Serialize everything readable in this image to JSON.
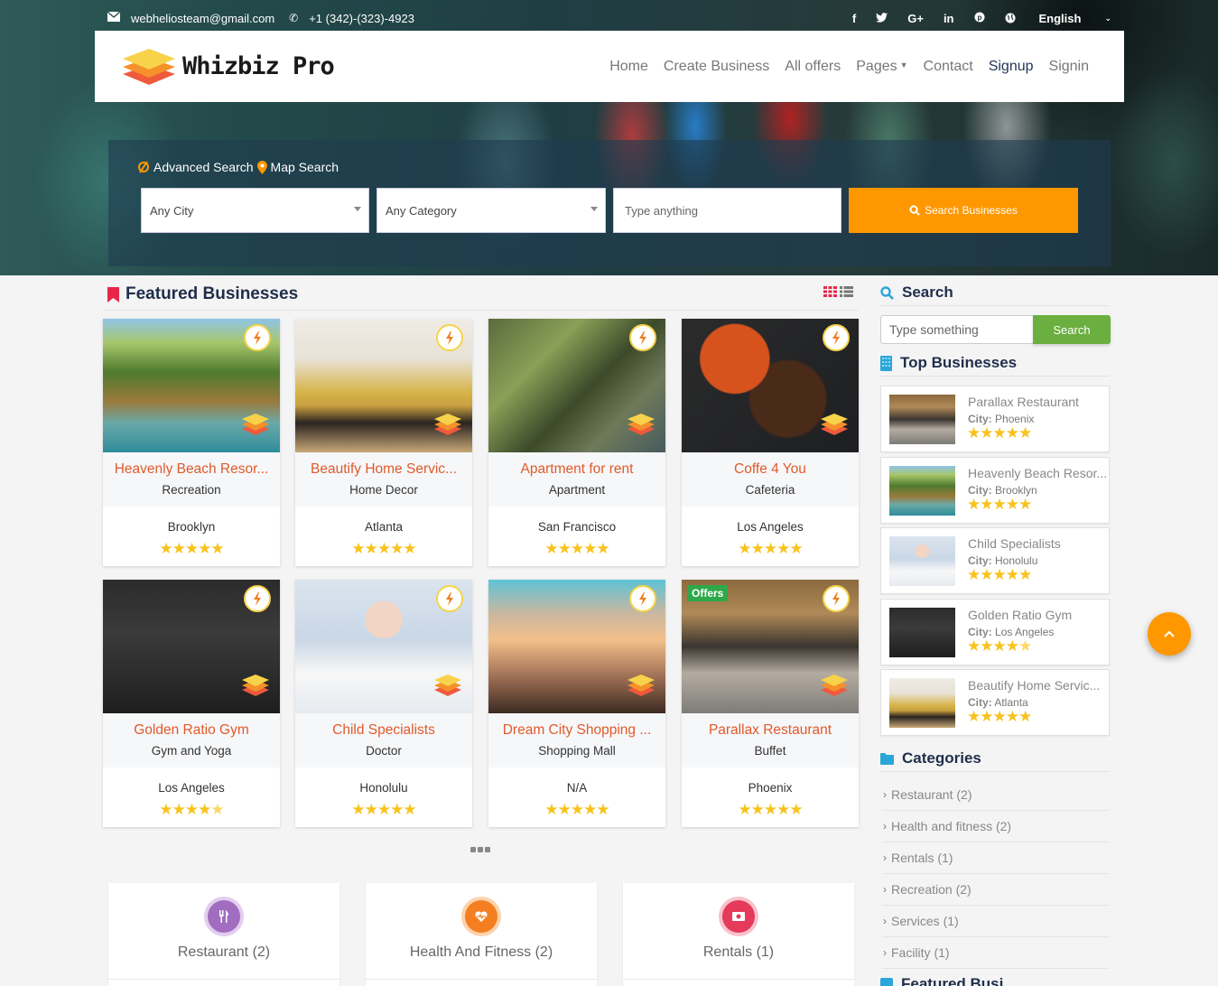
{
  "topbar": {
    "email": "webheliosteam@gmail.com",
    "phone": "+1 (342)-(323)-4923",
    "social": [
      {
        "icon": "facebook-icon",
        "glyph": "f"
      },
      {
        "icon": "twitter-icon",
        "glyph": "🐦"
      },
      {
        "icon": "google-plus-icon",
        "glyph": "G+"
      },
      {
        "icon": "linkedin-icon",
        "glyph": "in"
      },
      {
        "icon": "pinterest-icon",
        "glyph": "℗"
      }
    ],
    "language": "English"
  },
  "brand": {
    "name": "Whizbiz Pro"
  },
  "nav": {
    "items": [
      "Home",
      "Create Business",
      "All offers",
      "Pages",
      "Contact",
      "Signup",
      "Signin"
    ],
    "active": "Signup"
  },
  "hero_search": {
    "tab_advanced": "Advanced Search",
    "tab_map": "Map Search",
    "city_select": "Any City",
    "category_select": "Any Category",
    "keyword_placeholder": "Type anything",
    "button_label": "Search Businesses"
  },
  "featured": {
    "title": "Featured Businesses",
    "cards": [
      {
        "name": "Heavenly Beach Resor...",
        "category": "Recreation",
        "city": "Brooklyn",
        "rating": 5,
        "offer": false,
        "theme": "beach"
      },
      {
        "name": "Beautify Home Servic...",
        "category": "Home Decor",
        "city": "Atlanta",
        "rating": 5,
        "offer": false,
        "theme": "home"
      },
      {
        "name": "Apartment for rent",
        "category": "Apartment",
        "city": "San Francisco",
        "rating": 5,
        "offer": false,
        "theme": "apartment"
      },
      {
        "name": "Coffe 4 You",
        "category": "Cafeteria",
        "city": "Los Angeles",
        "rating": 5,
        "offer": false,
        "theme": "coffee"
      },
      {
        "name": "Golden Ratio Gym",
        "category": "Gym and Yoga",
        "city": "Los Angeles",
        "rating": 4,
        "offer": false,
        "theme": "gym"
      },
      {
        "name": "Child Specialists",
        "category": "Doctor",
        "city": "Honolulu",
        "rating": 5,
        "offer": false,
        "theme": "doctor"
      },
      {
        "name": "Dream City Shopping ...",
        "category": "Shopping Mall",
        "city": "N/A",
        "rating": 5,
        "offer": false,
        "theme": "mall"
      },
      {
        "name": "Parallax Restaurant",
        "category": "Buffet",
        "city": "Phoenix",
        "rating": 5,
        "offer": true,
        "theme": "restaurant"
      }
    ],
    "offer_badge": "Offers"
  },
  "category_boxes": [
    {
      "label": "Restaurant (2)",
      "color": "#a06dc0",
      "ring": "#e3cdee",
      "icon": "utensils-icon",
      "glyph": "🍴"
    },
    {
      "label": "Health And Fitness (2)",
      "color": "#f47f20",
      "ring": "#fbd3ad",
      "icon": "heartbeat-icon",
      "glyph": "♥"
    },
    {
      "label": "Rentals (1)",
      "color": "#e63a5a",
      "ring": "#f7c2cc",
      "icon": "money-icon",
      "glyph": "$"
    }
  ],
  "sidebar": {
    "search_title": "Search",
    "search_placeholder": "Type something",
    "search_button": "Search",
    "top_title": "Top Businesses",
    "city_label": "City:",
    "top_businesses": [
      {
        "name": "Parallax Restaurant",
        "city": "Phoenix",
        "rating": 5,
        "theme": "restaurant"
      },
      {
        "name": "Heavenly Beach Resor...",
        "city": "Brooklyn",
        "rating": 5,
        "theme": "beach"
      },
      {
        "name": "Child Specialists",
        "city": "Honolulu",
        "rating": 5,
        "theme": "doctor"
      },
      {
        "name": "Golden Ratio Gym",
        "city": "Los Angeles",
        "rating": 4,
        "theme": "gym"
      },
      {
        "name": "Beautify Home Servic...",
        "city": "Atlanta",
        "rating": 5,
        "theme": "home"
      }
    ],
    "categories_title": "Categories",
    "categories": [
      "Restaurant (2)",
      "Health and fitness (2)",
      "Rentals (1)",
      "Recreation (2)",
      "Services (1)",
      "Facility (1)"
    ],
    "next_title": "Featured Busi..."
  },
  "colors": {
    "accent_orange": "#ff9800",
    "title_orange": "#e05a2b",
    "search_green": "#6aaf3f",
    "heading_navy": "#1f2e4a",
    "offer_green": "#2ea84a"
  }
}
